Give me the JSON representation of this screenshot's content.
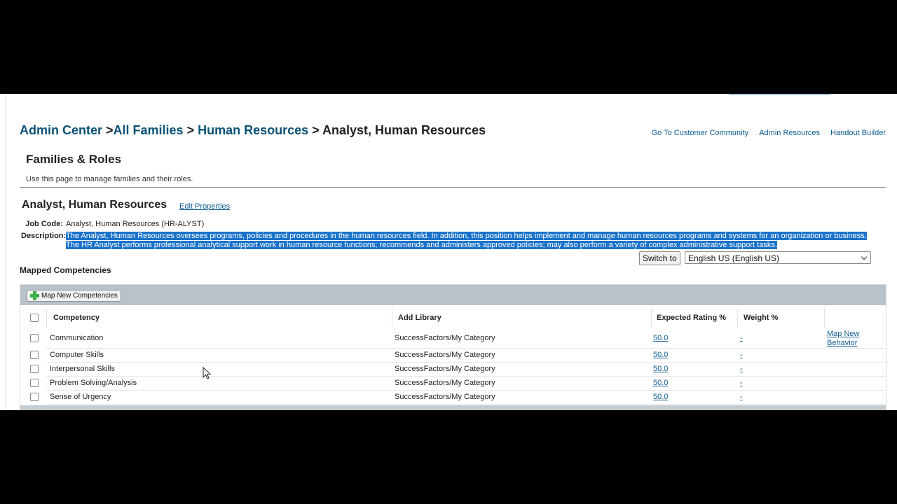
{
  "breadcrumb": {
    "admin_center": "Admin Center",
    "sep1": " >",
    "all_families": "All Families",
    "sep2": " > ",
    "human_resources": "Human Resources",
    "sep3": " > ",
    "current": "Analyst, Human Resources"
  },
  "top_links": [
    "Go To Customer Community",
    "Admin Resources",
    "Handout Builder"
  ],
  "section": {
    "title": "Families & Roles",
    "description": "Use this page to manage families and their roles."
  },
  "role": {
    "title": "Analyst, Human Resources",
    "edit_label": "Edit Properties",
    "job_code_label": "Job Code:",
    "job_code": "Analyst, Human Resources (HR-ALYST)",
    "description_label": "Description:",
    "description": "The Analyst, Human Resources oversees programs, policies and procedures in the human resources field. In addition, this position helps implement and manage human resources programs and systems for an organization or business. The HR Analyst performs professional analytical support work in human resource functions; recommends and administers approved policies; may also perform a variety of complex administrative support tasks."
  },
  "language": {
    "switch_label": "Switch to",
    "selected": "English US (English US)"
  },
  "mapped": {
    "title": "Mapped Competencies",
    "map_button": "Map New Competencies",
    "columns": {
      "competency": "Competency",
      "library": "Add Library",
      "expected": "Expected Rating %",
      "weight": "Weight %"
    },
    "rows": [
      {
        "competency": "Communication",
        "library": "SuccessFactors/My Category",
        "expected": "50.0",
        "weight": "-",
        "action": "Map New Behavior"
      },
      {
        "competency": "Computer Skills",
        "library": "SuccessFactors/My Category",
        "expected": "50.0",
        "weight": "-"
      },
      {
        "competency": "Interpersonal Skills",
        "library": "SuccessFactors/My Category",
        "expected": "50.0",
        "weight": "-"
      },
      {
        "competency": "Problem Solving/Analysis",
        "library": "SuccessFactors/My Category",
        "expected": "50.0",
        "weight": "-"
      },
      {
        "competency": "Sense of Urgency",
        "library": "SuccessFactors/My Category",
        "expected": "50.0",
        "weight": "-"
      }
    ]
  },
  "icons": {
    "add": "plus-icon",
    "dropdown": "chevron-down-icon",
    "cursor": "mouse-pointer-icon"
  },
  "colors": {
    "link": "#0b5275",
    "selection": "#1a73c9",
    "toolbar": "#b9c2c8"
  }
}
